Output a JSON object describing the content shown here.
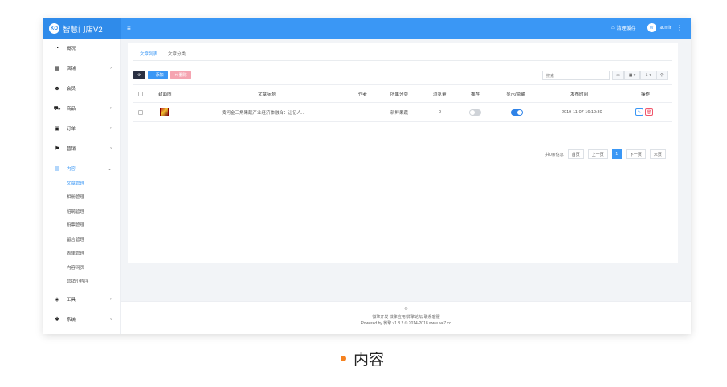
{
  "app": {
    "logo_mark": "KO",
    "title": "智慧门店V2",
    "menu_toggle": "≡"
  },
  "topbar": {
    "cache_label": "清理缓存",
    "user_initial": "W",
    "user_name": "admin",
    "more": "⋮"
  },
  "sidebar": {
    "items": [
      {
        "label": "概况",
        "icon": "dashboard-icon",
        "glyph": "◔",
        "arrow": ""
      },
      {
        "label": "店铺",
        "icon": "grid-icon",
        "glyph": "▦",
        "arrow": "›"
      },
      {
        "label": "会员",
        "icon": "users-icon",
        "glyph": "☻",
        "arrow": ""
      },
      {
        "label": "商品",
        "icon": "cart-icon",
        "glyph": "⛟",
        "arrow": "›"
      },
      {
        "label": "订单",
        "icon": "order-icon",
        "glyph": "▣",
        "arrow": "›"
      },
      {
        "label": "营销",
        "icon": "flag-icon",
        "glyph": "⚑",
        "arrow": "›"
      },
      {
        "label": "内容",
        "icon": "document-icon",
        "glyph": "▤",
        "arrow": "⌄"
      },
      {
        "label": "工具",
        "icon": "box-icon",
        "glyph": "◈",
        "arrow": "›"
      },
      {
        "label": "系统",
        "icon": "gear-icon",
        "glyph": "✱",
        "arrow": "›"
      }
    ],
    "subitems": [
      "文章管理",
      "相册管理",
      "招聘管理",
      "投票管理",
      "留言管理",
      "表单管理",
      "内容网页",
      "营销小程序"
    ]
  },
  "tabs": [
    "文章列表",
    "文章分类"
  ],
  "toolbar": {
    "refresh": "⟳",
    "add": "+ 添加",
    "delete": "✕ 删除"
  },
  "search": {
    "placeholder": "搜索"
  },
  "table_tools": [
    "▭",
    "▦ ▾",
    "⇩ ▾",
    "⚲"
  ],
  "table": {
    "headers": [
      "封面图",
      "文章标题",
      "作者",
      "所属分类",
      "浏览量",
      "推荐",
      "显示/隐藏",
      "发布时间",
      "操作"
    ],
    "rows": [
      {
        "title": "黄河金三角果蔬产业经济体融合：让亿人...",
        "author": "",
        "category": "新鲜果蔬",
        "views": "0",
        "recommend": false,
        "visible": true,
        "time": "2019-11-07 16:10:30"
      }
    ]
  },
  "pagination": {
    "info": "共0条信息",
    "first": "首页",
    "prev": "上一页",
    "current": "1",
    "next": "下一页",
    "last": "末页"
  },
  "footer": {
    "icon": "©",
    "links": "微擎开发 微擎应用 微擎论坛 联系客服",
    "powered": "Powered by 微擎 v1.8.2 © 2014-2018 www.we7.cc"
  },
  "caption": "内容",
  "colors": {
    "primary": "#3a97f5",
    "caption_dot": "#f58220",
    "danger": "#f0566b"
  }
}
